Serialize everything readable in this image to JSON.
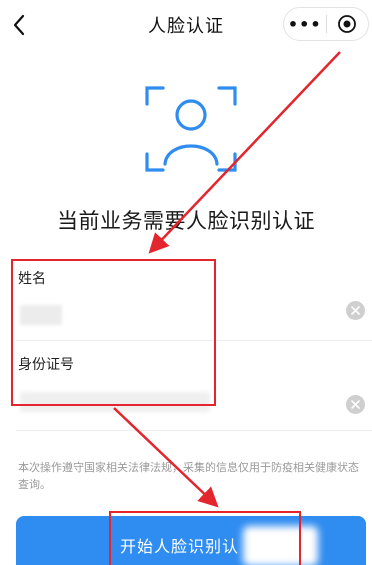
{
  "nav": {
    "title": "人脸认证",
    "more_label": "•••",
    "back_icon": "chevron-left-icon",
    "close_icon": "target-icon"
  },
  "face_icon": "face-scan-icon",
  "headline": "当前业务需要人脸识别认证",
  "form": {
    "name_label": "姓名",
    "id_label": "身份证号",
    "clear_icon": "clear-icon"
  },
  "notice": "本次操作遵守国家相关法律法规，采集的信息仅用于防疫相关健康状态查询。",
  "start_button": {
    "label": "开始人脸识别认"
  },
  "colors": {
    "primary": "#2f8cf0",
    "annotation": "#e3262e",
    "muted": "#9a9a9a"
  }
}
